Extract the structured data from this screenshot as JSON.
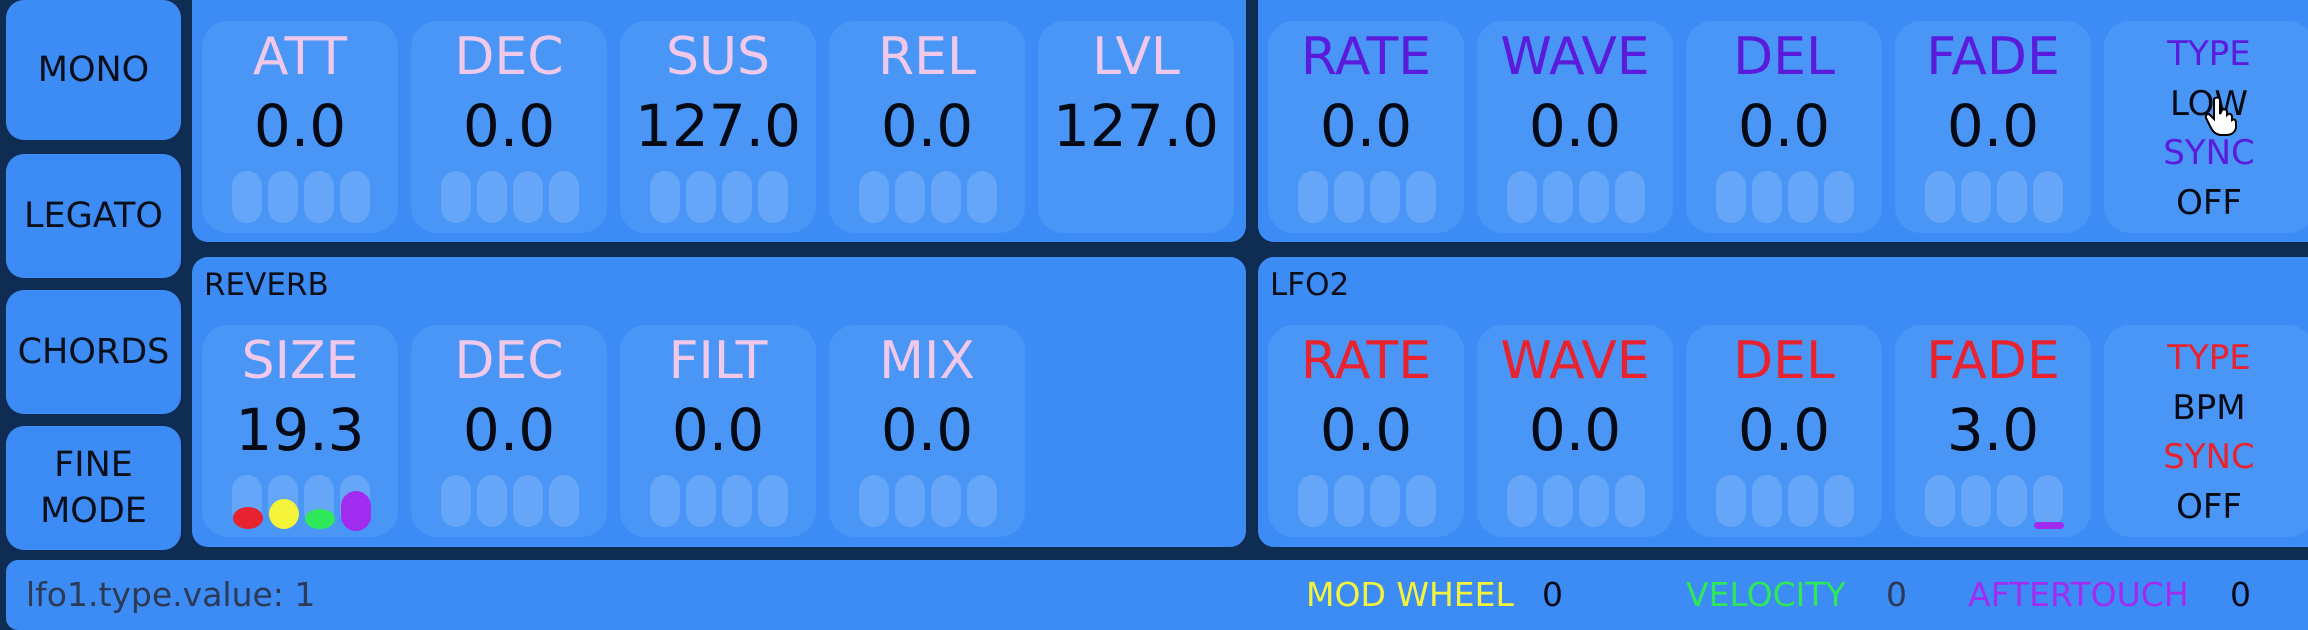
{
  "side_buttons": [
    "MONO",
    "LEGATO",
    "CHORDS",
    "FINE MODE"
  ],
  "env": {
    "controls": [
      {
        "label": "ATT",
        "value": "0.0"
      },
      {
        "label": "DEC",
        "value": "0.0"
      },
      {
        "label": "SUS",
        "value": "127.0"
      },
      {
        "label": "REL",
        "value": "0.0"
      },
      {
        "label": "LVL",
        "value": "127.0"
      }
    ]
  },
  "lfo1": {
    "controls": [
      {
        "label": "RATE",
        "value": "0.0"
      },
      {
        "label": "WAVE",
        "value": "0.0"
      },
      {
        "label": "DEL",
        "value": "0.0"
      },
      {
        "label": "FADE",
        "value": "0.0"
      }
    ],
    "type_label": "TYPE",
    "type_value": "LOW",
    "sync_label": "SYNC",
    "sync_value": "OFF"
  },
  "reverb": {
    "title": "REVERB",
    "controls": [
      {
        "label": "SIZE",
        "value": "19.3"
      },
      {
        "label": "DEC",
        "value": "0.0"
      },
      {
        "label": "FILT",
        "value": "0.0"
      },
      {
        "label": "MIX",
        "value": "0.0"
      }
    ]
  },
  "lfo2": {
    "title": "LFO2",
    "controls": [
      {
        "label": "RATE",
        "value": "0.0"
      },
      {
        "label": "WAVE",
        "value": "0.0"
      },
      {
        "label": "DEL",
        "value": "0.0"
      },
      {
        "label": "FADE",
        "value": "3.0"
      }
    ],
    "type_label": "TYPE",
    "type_value": "BPM",
    "sync_label": "SYNC",
    "sync_value": "OFF"
  },
  "status": {
    "debug": "lfo1.type.value: 1",
    "mod_wheel_label": "MOD WHEEL",
    "mod_wheel_value": "0",
    "velocity_label": "VELOCITY",
    "velocity_value": "0",
    "aftertouch_label": "AFTERTOUCH",
    "aftertouch_value": "0"
  },
  "colors": {
    "env_label": "#f0c8ea",
    "lfo1_label": "#5a1bdc",
    "lfo2_label": "#e8222e",
    "mod_wheel": "#f5f33a",
    "velocity": "#2ee85a",
    "aftertouch": "#a12cf0"
  },
  "icons": [
    "hand-pointer-icon"
  ]
}
